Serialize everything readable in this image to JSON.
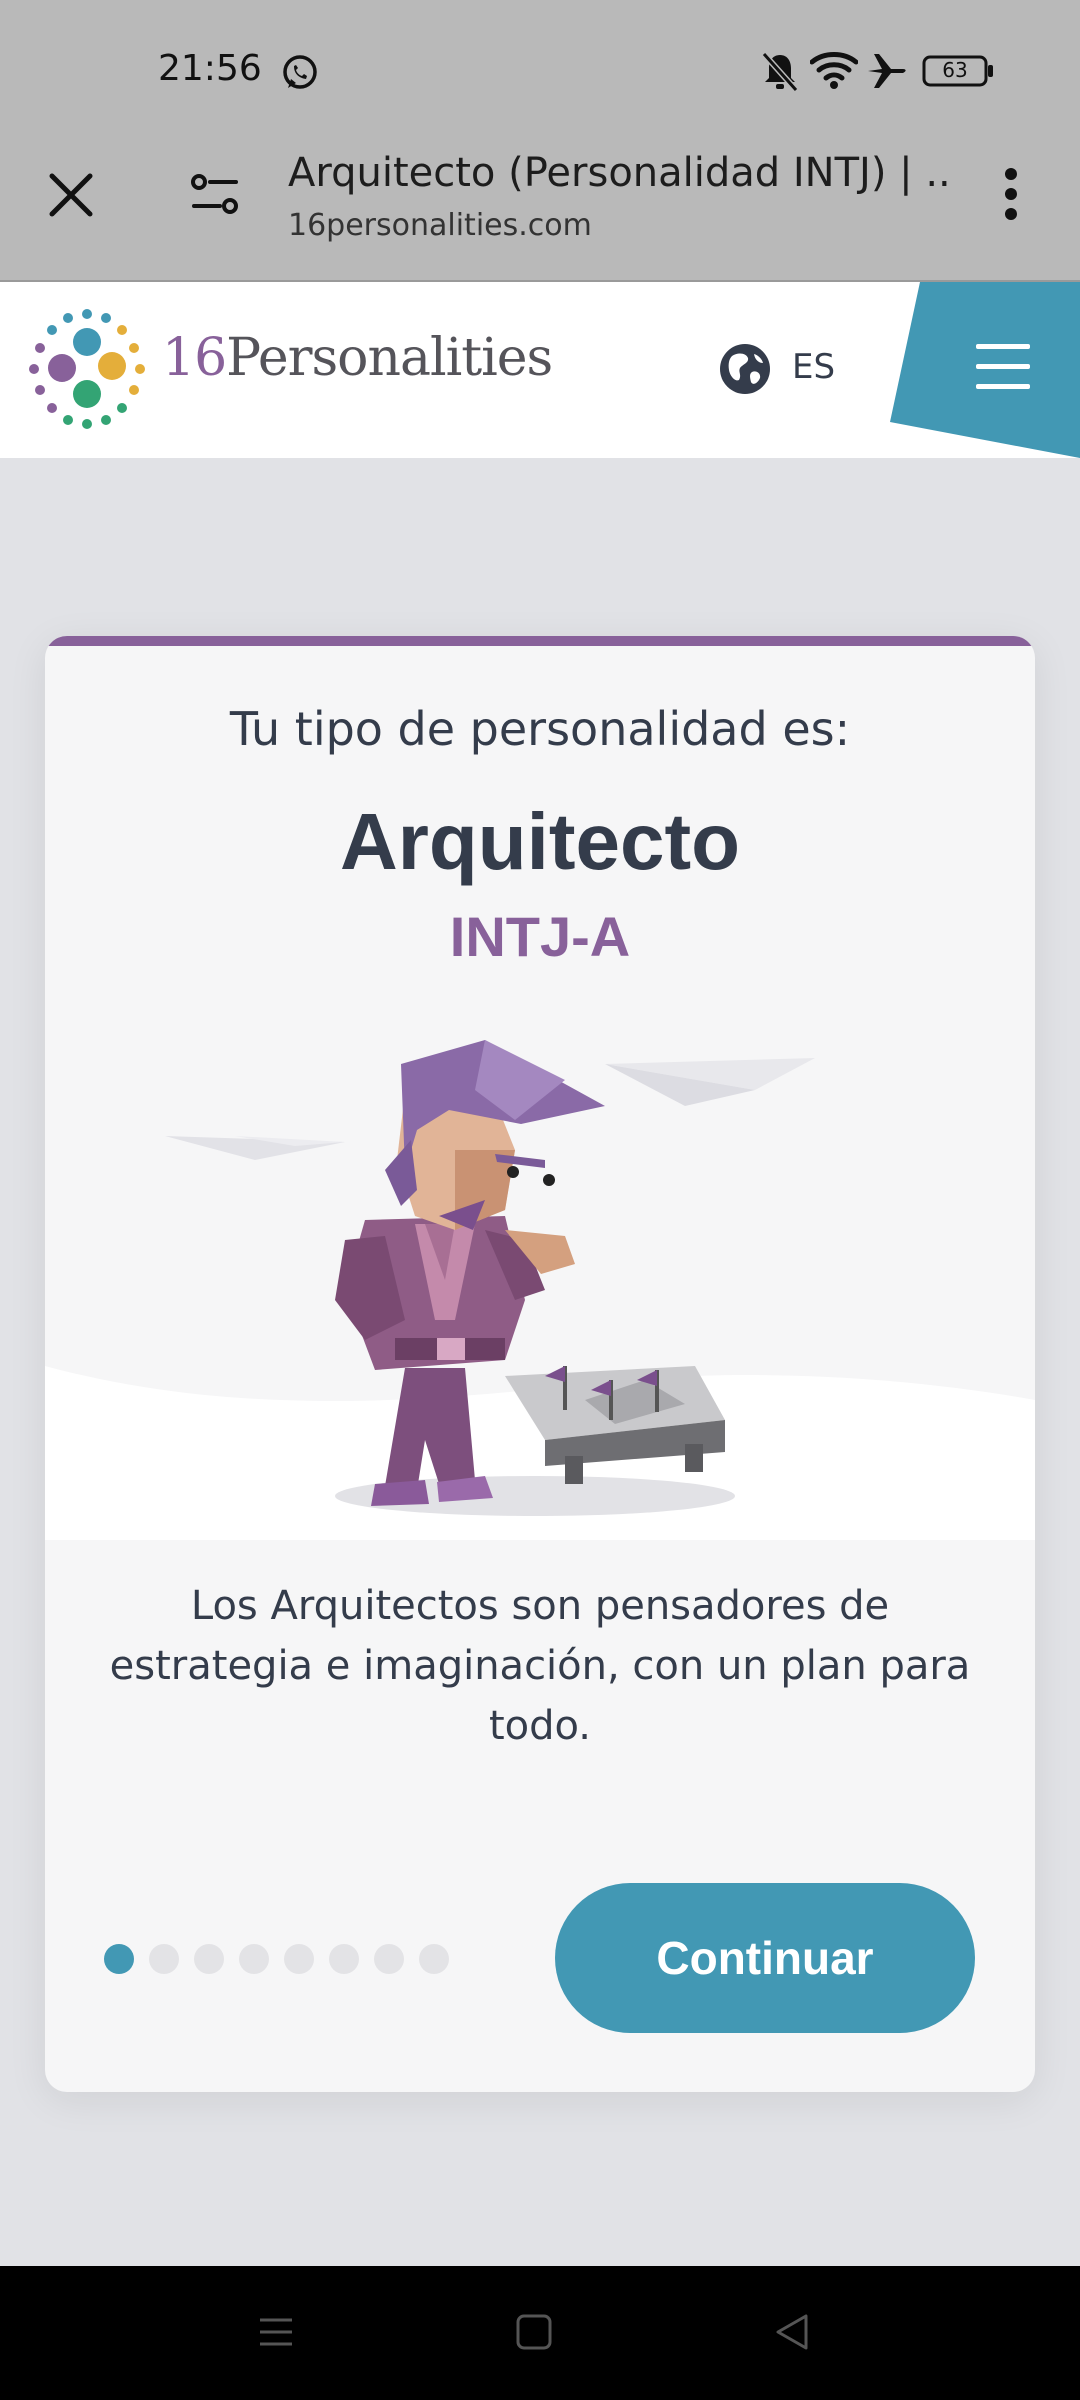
{
  "status_bar": {
    "time": "21:56",
    "battery": "63",
    "icons": [
      "whatsapp-icon",
      "bell-muted-icon",
      "wifi-icon",
      "airplane-icon",
      "battery-icon"
    ]
  },
  "browser": {
    "page_title": "Arquitecto (Personalidad INTJ) | ...",
    "domain": "16personalities.com",
    "icons": [
      "close-icon",
      "site-settings-icon",
      "more-vert-icon"
    ]
  },
  "site_header": {
    "logo_number": "16",
    "logo_text": "Personalities",
    "language": "ES",
    "icons": [
      "logo-dots-icon",
      "globe-icon",
      "hamburger-menu-icon"
    ]
  },
  "card": {
    "heading": "Tu tipo de personalidad es:",
    "type_name": "Arquitecto",
    "type_code": "INTJ-A",
    "description": "Los Arquitectos son pensadores de estrategia e imaginación, con un plan para todo.",
    "continue_label": "Continuar",
    "pagination": {
      "total": 8,
      "current": 1
    }
  },
  "colors": {
    "accent_blue": "#4298b4",
    "analyst_purple": "#88619a",
    "text_dark": "#343c4b",
    "page_bg": "#e1e2e6"
  }
}
